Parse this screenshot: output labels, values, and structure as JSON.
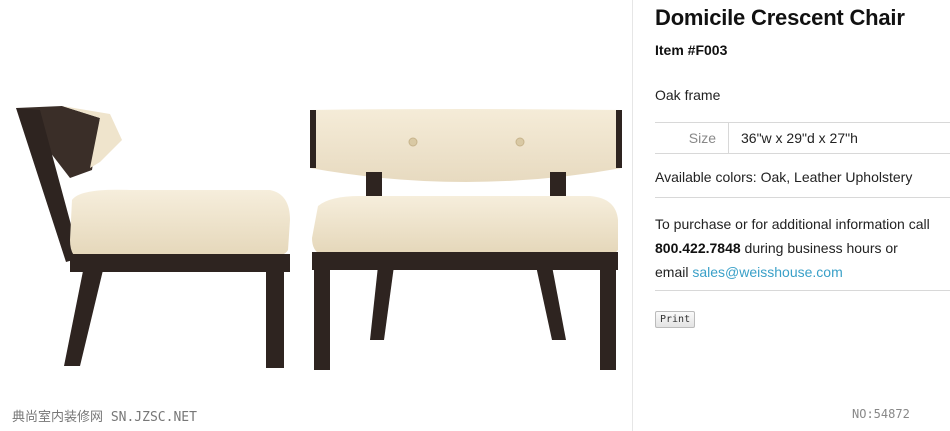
{
  "product": {
    "title": "Domicile Crescent Chair",
    "item_number": "Item #F003",
    "frame": "Oak frame",
    "spec": {
      "label": "Size",
      "value": "36\"w x 29\"d x 27\"h"
    },
    "colors": "Available colors: Oak, Leather Upholstery"
  },
  "purchase": {
    "intro": "To purchase or for additional information call",
    "phone": "800.422.7848",
    "middle": " during business hours or",
    "email_prefix": "email ",
    "email": "sales@weisshouse.com"
  },
  "actions": {
    "print_label": "Print"
  },
  "watermark": {
    "left": "典尚室内装修网 SN.JZSC.NET",
    "right": "NO:54872"
  },
  "colors": {
    "upholstery": "#efe4cc",
    "wood": "#2e2420",
    "link": "#3aa0c8"
  }
}
